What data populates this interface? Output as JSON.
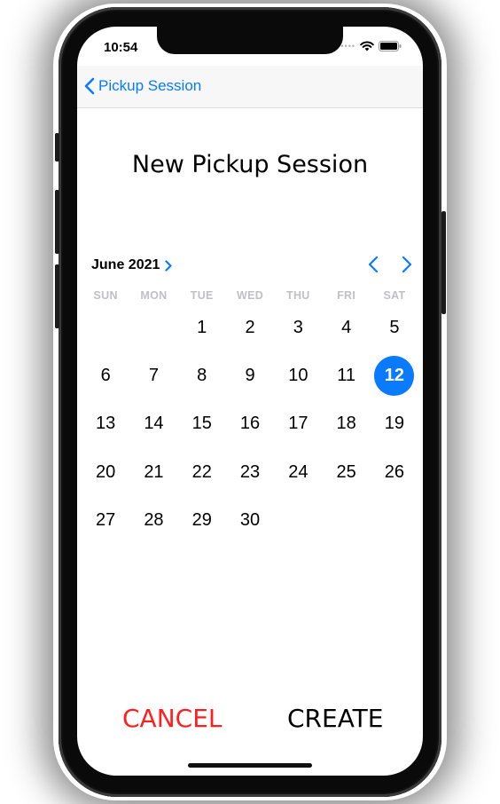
{
  "status_bar": {
    "time": "10:54"
  },
  "navbar": {
    "back_label": "Pickup Session"
  },
  "page": {
    "title": "New Pickup Session"
  },
  "calendar": {
    "month_label": "June 2021",
    "weekdays": [
      "SUN",
      "MON",
      "TUE",
      "WED",
      "THU",
      "FRI",
      "SAT"
    ],
    "weeks": [
      [
        "",
        "",
        "1",
        "2",
        "3",
        "4",
        "5"
      ],
      [
        "6",
        "7",
        "8",
        "9",
        "10",
        "11",
        "12"
      ],
      [
        "13",
        "14",
        "15",
        "16",
        "17",
        "18",
        "19"
      ],
      [
        "20",
        "21",
        "22",
        "23",
        "24",
        "25",
        "26"
      ],
      [
        "27",
        "28",
        "29",
        "30",
        "",
        "",
        ""
      ]
    ],
    "selected_day": "12"
  },
  "actions": {
    "cancel_label": "CANCEL",
    "create_label": "CREATE"
  },
  "colors": {
    "accent": "#0a7aff",
    "cancel": "#ff1f1f"
  }
}
